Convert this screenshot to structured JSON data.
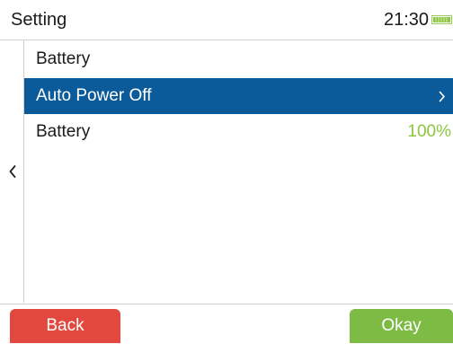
{
  "status_bar": {
    "title": "Setting",
    "time": "21:30",
    "battery_icon": "battery-full-icon",
    "battery_color": "#8cc63f"
  },
  "nav": {
    "back_icon": "chevron-left-icon"
  },
  "menu": {
    "header": "Battery",
    "items": [
      {
        "label": "Auto Power Off",
        "value": "",
        "selected": true,
        "icon": "chevron-right-icon"
      },
      {
        "label": "Battery",
        "value": "100%",
        "selected": false
      }
    ]
  },
  "footer": {
    "back_label": "Back",
    "okay_label": "Okay"
  },
  "colors": {
    "selection": "#0b5a99",
    "back_button": "#e2483e",
    "okay_button": "#7dbb45",
    "value_text": "#8cc63f"
  }
}
